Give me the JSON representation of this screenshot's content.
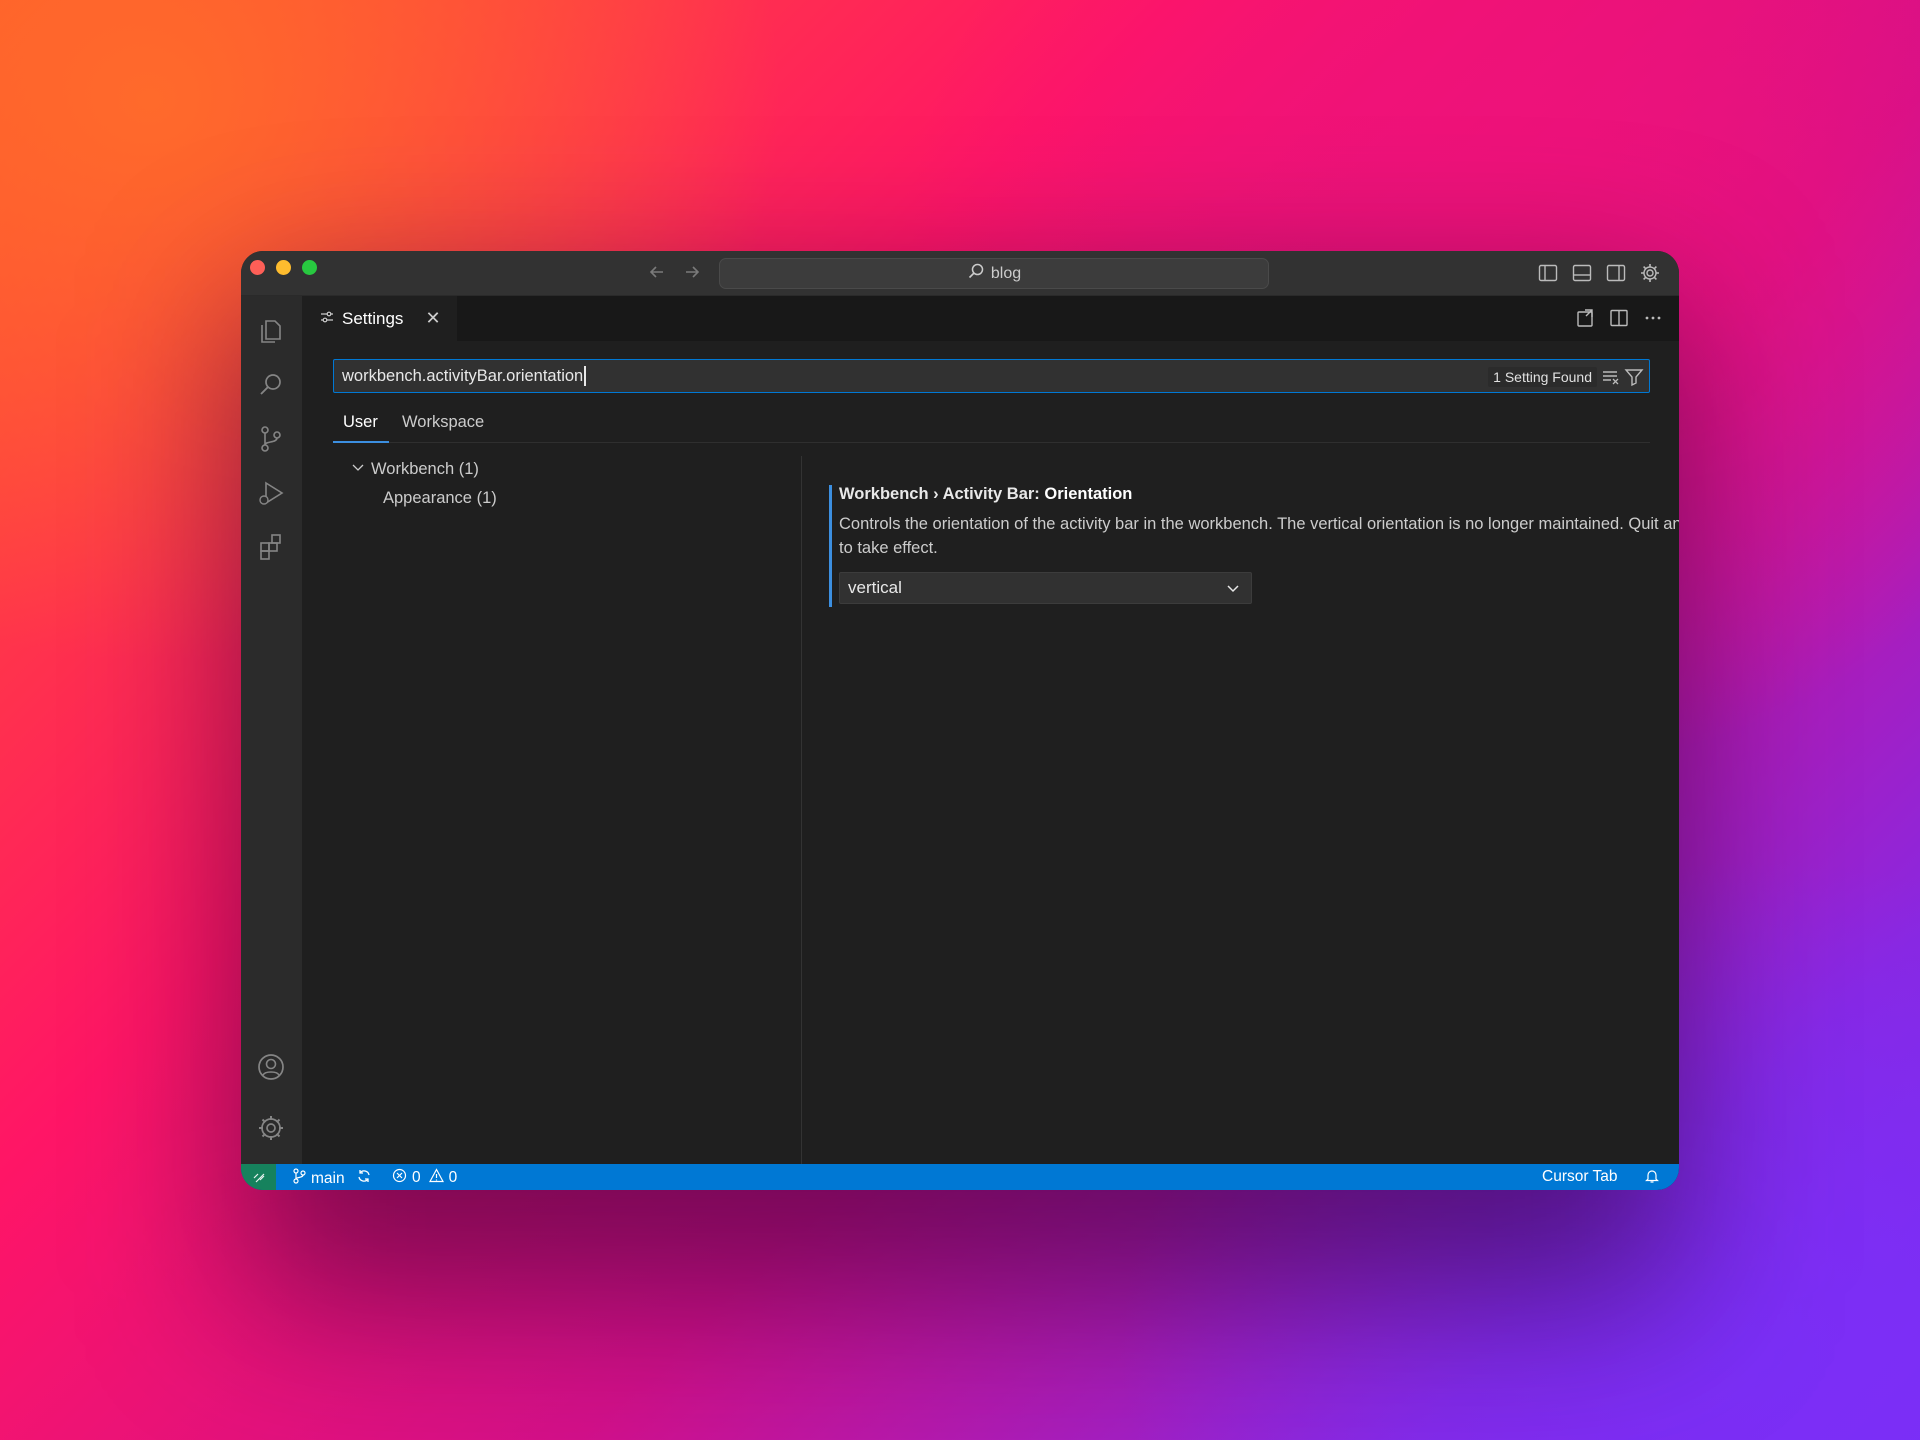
{
  "titlebar": {
    "search_text": "blog"
  },
  "tab": {
    "label": "Settings"
  },
  "search": {
    "value": "workbench.activityBar.orientation",
    "result_count": "1 Setting Found"
  },
  "scope_tabs": [
    {
      "label": "User",
      "active": true
    },
    {
      "label": "Workspace",
      "active": false
    }
  ],
  "toc": {
    "group_label": "Workbench (1)",
    "child_label": "Appearance (1)"
  },
  "setting": {
    "title_prefix": "Workbench › Activity Bar: ",
    "title_name": "Orientation",
    "description": "Controls the orientation of the activity bar in the workbench. The vertical orientation is no longer maintained. Quit and reopen for changes to take effect.",
    "value": "vertical"
  },
  "statusbar": {
    "branch": "main",
    "errors": "0",
    "warnings": "0",
    "right_label": "Cursor Tab"
  },
  "colors": {
    "accent": "#0078d4",
    "remote": "#16825d",
    "editor_bg": "#1f1f1f"
  }
}
